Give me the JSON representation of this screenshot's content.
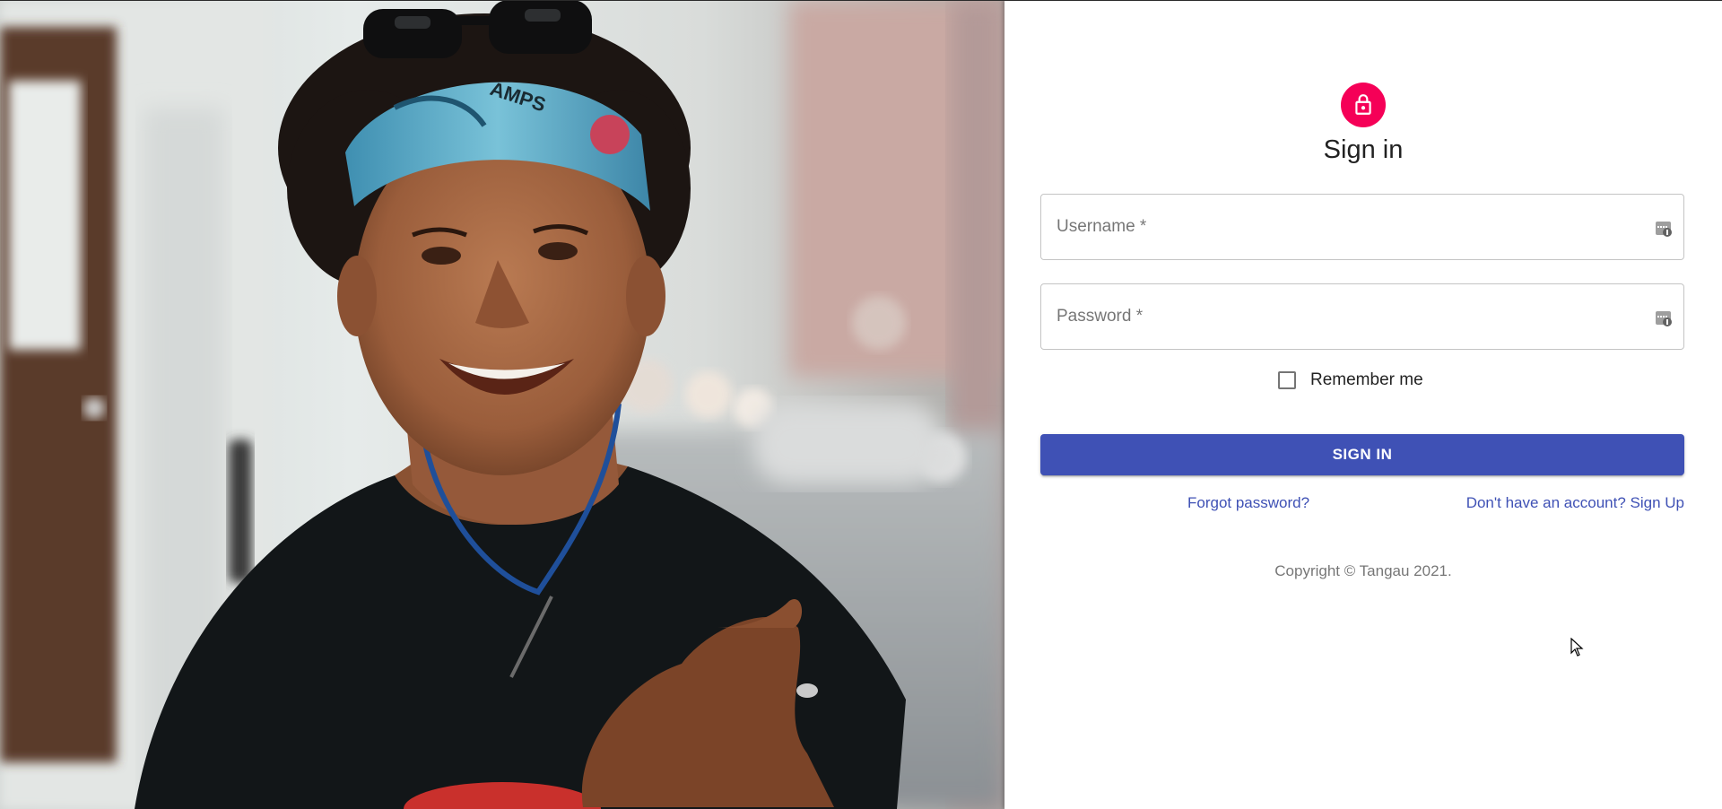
{
  "colors": {
    "avatar_bg": "#f50057",
    "primary": "#3f51b5",
    "text_secondary": "rgba(0,0,0,0.54)"
  },
  "hero": {
    "icon": "portrait-photo"
  },
  "form": {
    "lock_icon": "lock-outlined-icon",
    "title": "Sign in",
    "username": {
      "placeholder": "Username *",
      "value": "",
      "icon": "password-manager-key-icon"
    },
    "password": {
      "placeholder": "Password *",
      "value": "",
      "icon": "password-manager-key-icon"
    },
    "remember_label": "Remember me",
    "remember_checked": false,
    "submit_label": "SIGN IN",
    "forgot_link": "Forgot password?",
    "signup_link": "Don't have an account? Sign Up"
  },
  "footer": {
    "copyright": "Copyright © Tangau 2021."
  }
}
